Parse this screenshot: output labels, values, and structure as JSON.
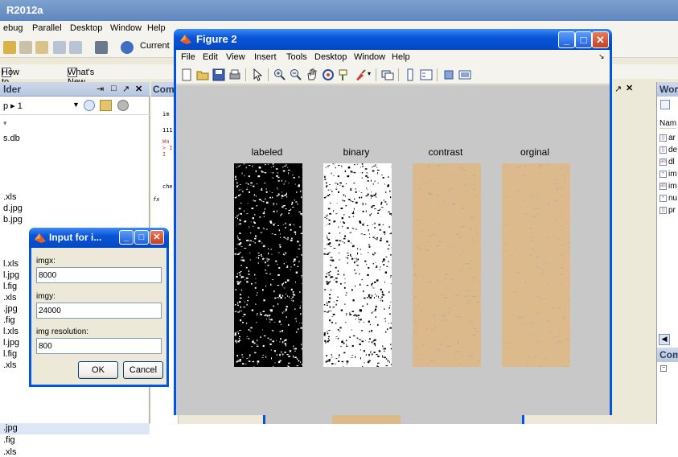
{
  "matlab": {
    "title": "R2012a",
    "menu": [
      "ebug",
      "Parallel",
      "Desktop",
      "Window",
      "Help"
    ],
    "current_label": "Current",
    "shortcuts": [
      "How to Add",
      "What's New"
    ],
    "folder_panel": {
      "title": "lder",
      "path": "p ▸ 1",
      "files": [
        "s.db",
        ".xls",
        "d.jpg",
        "b.jpg",
        "l.xls",
        "l.jpg",
        "l.fig",
        ".xls",
        ".jpg",
        ".fig",
        "l.xls",
        "l.jpg",
        "l.fig",
        ".xls",
        ".jpg",
        ".fig",
        ".xls"
      ]
    },
    "command_panel": {
      "title": "Comr",
      "lines": [
        "im",
        "111",
        "Wa",
        "> I",
        "I",
        "che",
        "fx"
      ]
    },
    "workspace_panel": {
      "title": "Wor",
      "header": "Nam",
      "rows": [
        "ar",
        "de",
        "dl",
        "im",
        "im",
        "nu",
        "pr"
      ],
      "footer_title": "Com"
    }
  },
  "figure": {
    "title": "Figure 2",
    "menu": [
      "File",
      "Edit",
      "View",
      "Insert",
      "Tools",
      "Desktop",
      "Window",
      "Help"
    ],
    "images": [
      {
        "label": "labeled"
      },
      {
        "label": "binary"
      },
      {
        "label": "contrast"
      },
      {
        "label": "orginal"
      }
    ]
  },
  "dialog": {
    "title": "Input for i...",
    "fields": [
      {
        "label": "imgx:",
        "value": "8000"
      },
      {
        "label": "imgy:",
        "value": "24000"
      },
      {
        "label": "img resolution:",
        "value": "800"
      }
    ],
    "ok_label": "OK",
    "cancel_label": "Cancel"
  },
  "colors": {
    "xp_title_blue": "#0a55d8",
    "matlab_title": "#6a90c6",
    "texture_beige": "#dcb98b",
    "canvas_gray": "#c8c8c8"
  }
}
